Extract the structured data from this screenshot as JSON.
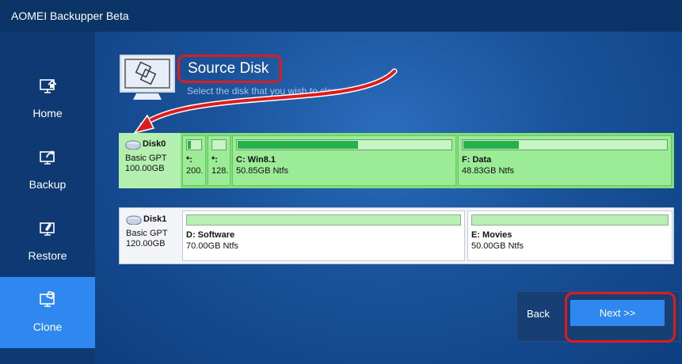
{
  "window": {
    "title": "AOMEI Backupper Beta"
  },
  "sidebar": {
    "items": [
      {
        "label": "Home",
        "icon": "home-icon"
      },
      {
        "label": "Backup",
        "icon": "backup-icon"
      },
      {
        "label": "Restore",
        "icon": "restore-icon"
      },
      {
        "label": "Clone",
        "icon": "clone-icon",
        "active": true
      }
    ]
  },
  "header": {
    "title": "Source Disk",
    "subtitle": "Select the disk that you wish to clone"
  },
  "disks": [
    {
      "name": "Disk0",
      "type": "Basic GPT",
      "size": "100.00GB",
      "selected": true,
      "partitions": [
        {
          "label": "*:",
          "desc": "200.",
          "used_fraction": 0.2
        },
        {
          "label": "*:",
          "desc": "128.",
          "used_fraction": 0.0
        },
        {
          "label": "C: Win8.1",
          "desc": "50.85GB Ntfs",
          "used_fraction": 0.56
        },
        {
          "label": "F: Data",
          "desc": "48.83GB Ntfs",
          "used_fraction": 0.27
        }
      ]
    },
    {
      "name": "Disk1",
      "type": "Basic GPT",
      "size": "120.00GB",
      "selected": false,
      "partitions": [
        {
          "label": "D: Software",
          "desc": "70.00GB Ntfs",
          "used_fraction": 0.0
        },
        {
          "label": "E: Movies",
          "desc": "50.00GB Ntfs",
          "used_fraction": 0.0
        }
      ]
    }
  ],
  "footer": {
    "back_label": "Back",
    "next_label": "Next >>"
  },
  "colors": {
    "accent": "#2f88ef",
    "selected_disk": "#7fe07a",
    "annotation": "#e01b1b"
  }
}
